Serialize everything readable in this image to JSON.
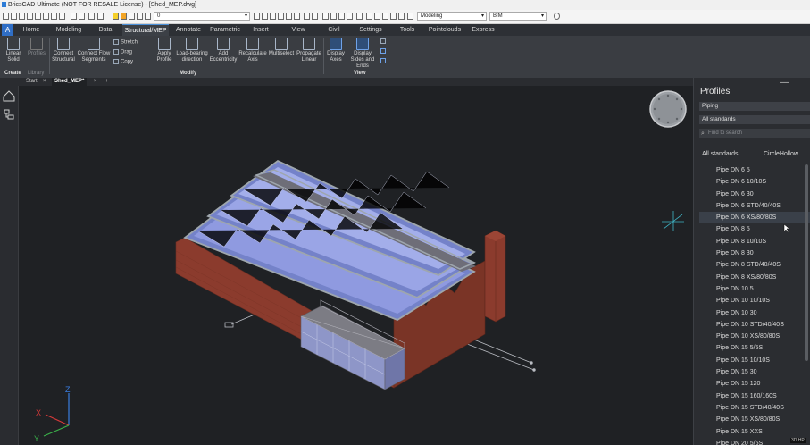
{
  "window": {
    "title": "BricsCAD Ultimate (NOT FOR RESALE License) - [Shed_MEP.dwg]"
  },
  "qat": {
    "layer_value": "0",
    "workspace": "Modeling",
    "mode": "BIM"
  },
  "ribbon_tabs": [
    "Home",
    "Modeling",
    "Data",
    "Structural/MEP",
    "Annotate",
    "Parametric",
    "Insert",
    "View",
    "Civil",
    "Settings",
    "Tools",
    "Pointclouds",
    "Express Tools"
  ],
  "active_tab": "Structural/MEP",
  "ribbon": {
    "create": {
      "label": "Create",
      "buttons": [
        "Linear Solid"
      ]
    },
    "library": {
      "label": "Library",
      "buttons": [
        "Profiles"
      ]
    },
    "modify": {
      "label": "Modify",
      "buttons": [
        "Connect Structural",
        "Connect Flow Segments",
        "Apply Profile",
        "Load-bearing direction",
        "Add Eccentricity",
        "Recalculate Axis",
        "Multiselect",
        "Propagate Linear"
      ],
      "small": [
        "Stretch",
        "Drag",
        "Copy"
      ]
    },
    "view": {
      "label": "View",
      "buttons": [
        "Display Axes",
        "Display Sides and Ends"
      ]
    }
  },
  "doc_tabs": [
    "Start",
    "Shed_MEP*"
  ],
  "viewport": {
    "axis_z": "Z",
    "axis_x": "X",
    "axis_y": "Y"
  },
  "profiles": {
    "title": "Profiles",
    "category": "Piping",
    "standard": "All standards",
    "search_placeholder": "Find to search",
    "tabs": [
      "All standards",
      "CircleHollow"
    ],
    "items": [
      "Pipe DN 6 5",
      "Pipe DN 6 10/10S",
      "Pipe DN 6 30",
      "Pipe DN 6 STD/40/40S",
      "Pipe DN 6 XS/80/80S",
      "Pipe DN 8 5",
      "Pipe DN 8 10/10S",
      "Pipe DN 8 30",
      "Pipe DN 8 STD/40/40S",
      "Pipe DN 8 XS/80/80S",
      "Pipe DN 10 5",
      "Pipe DN 10 10/10S",
      "Pipe DN 10 30",
      "Pipe DN 10 STD/40/40S",
      "Pipe DN 10 XS/80/80S",
      "Pipe DN 15 5/5S",
      "Pipe DN 15 10/10S",
      "Pipe DN 15 30",
      "Pipe DN 15 120",
      "Pipe DN 15 160/160S",
      "Pipe DN 15 STD/40/40S",
      "Pipe DN 15 XS/80/80S",
      "Pipe DN 15 XXS",
      "Pipe DN 20 5/5S"
    ],
    "selected_index": 4
  },
  "status": {
    "corner": "3D HP"
  }
}
